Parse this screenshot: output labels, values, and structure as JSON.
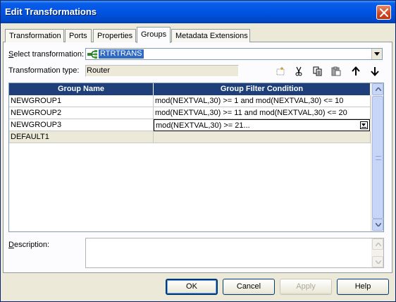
{
  "window": {
    "title": "Edit Transformations"
  },
  "tabs": [
    {
      "label": "Transformation"
    },
    {
      "label": "Ports"
    },
    {
      "label": "Properties"
    },
    {
      "label": "Groups"
    },
    {
      "label": "Metadata Extensions"
    }
  ],
  "active_tab": "Groups",
  "select_transformation": {
    "label_pre": "",
    "label_accel": "S",
    "label_post": "elect transformation:",
    "value": "RTRTRANS"
  },
  "transformation_type": {
    "label": "Transformation type:",
    "value": "Router"
  },
  "toolbar": {
    "icons": [
      "new-icon",
      "cut-icon",
      "copy-icon",
      "paste-icon",
      "move-up-icon",
      "move-down-icon"
    ]
  },
  "grid": {
    "columns": [
      "Group Name",
      "Group Filter Condition"
    ],
    "rows": [
      {
        "name": "NEWGROUP1",
        "condition": "mod(NEXTVAL,30) >= 1 and mod(NEXTVAL,30) <= 10"
      },
      {
        "name": "NEWGROUP2",
        "condition": "mod(NEXTVAL,30) >= 11 and mod(NEXTVAL,30) <= 20"
      },
      {
        "name": "NEWGROUP3",
        "condition": "mod(NEXTVAL,30) >= 21..."
      },
      {
        "name": "DEFAULT1",
        "condition": ""
      }
    ]
  },
  "description": {
    "label_accel": "D",
    "label_post": "escription:",
    "value": ""
  },
  "buttons": {
    "ok": "OK",
    "cancel": "Cancel",
    "apply": "Apply",
    "help": "Help"
  },
  "colors": {
    "title_bar": "#0054e3",
    "grid_header": "#1e3f7a",
    "selection": "#316ac5"
  }
}
